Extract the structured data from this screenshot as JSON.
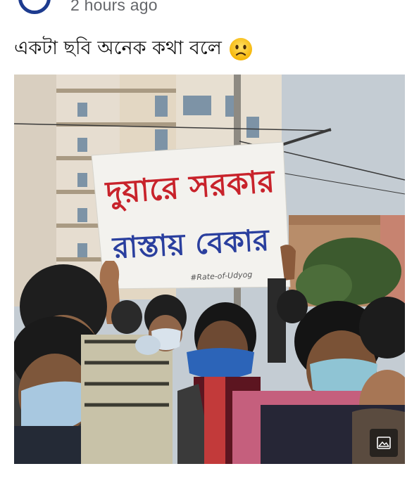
{
  "post": {
    "timestamp": "2 hours ago",
    "caption": "একটা ছবি অনেক কথা বলে",
    "caption_emoji": "worried-face-emoji"
  },
  "photo": {
    "sign_line1": "দুয়ারে সরকার",
    "sign_line2": "রাস্তায় বেকার",
    "sign_hashtag": "#Rate-of-Udyog",
    "gallery_button_icon": "image-icon"
  },
  "colors": {
    "timestamp": "#65676b",
    "sign_red": "#c8232b",
    "sign_blue": "#2a3f9e"
  }
}
